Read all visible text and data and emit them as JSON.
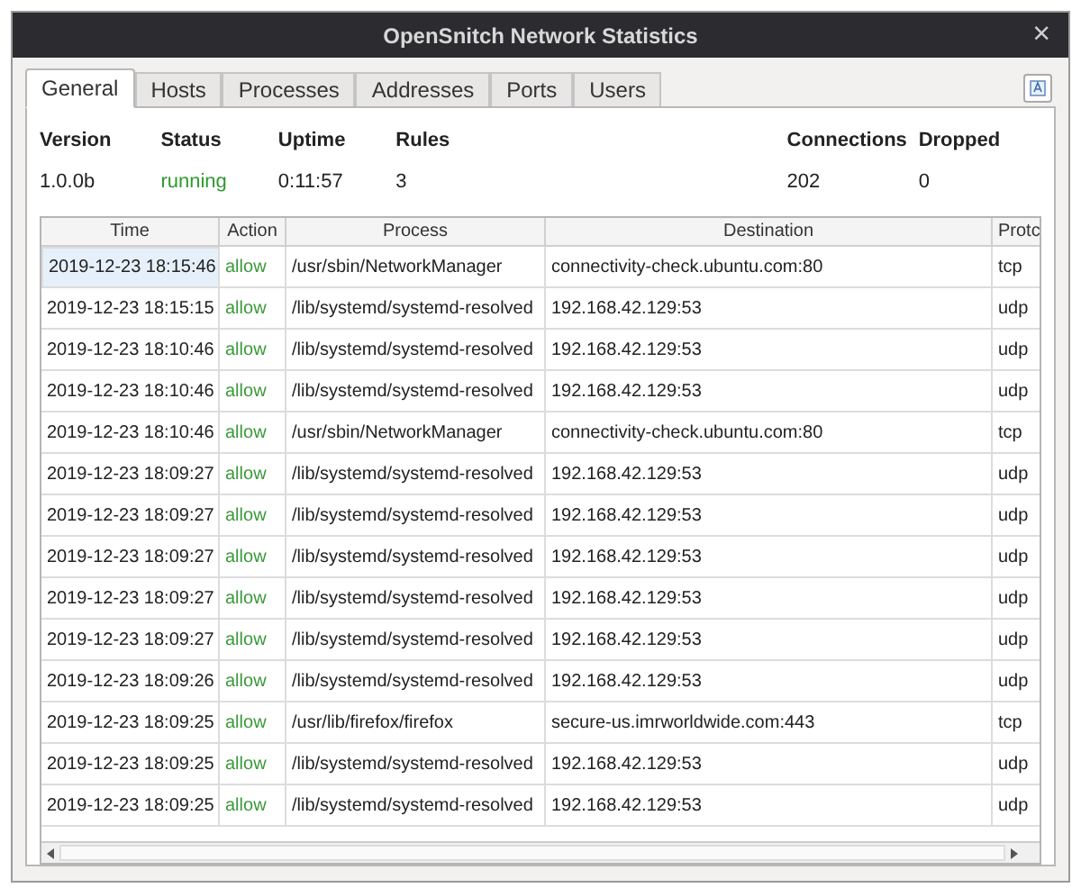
{
  "window": {
    "title": "OpenSnitch Network Statistics",
    "close": "×"
  },
  "tabs": [
    {
      "label": "General",
      "selected": true
    },
    {
      "label": "Hosts",
      "selected": false
    },
    {
      "label": "Processes",
      "selected": false
    },
    {
      "label": "Addresses",
      "selected": false
    },
    {
      "label": "Ports",
      "selected": false
    },
    {
      "label": "Users",
      "selected": false
    }
  ],
  "stats": [
    {
      "label": "Version",
      "value": "1.0.0b",
      "kind": "plain"
    },
    {
      "label": "Status",
      "value": "running",
      "kind": "status"
    },
    {
      "label": "Uptime",
      "value": "0:11:57",
      "kind": "plain"
    },
    {
      "label": "Rules",
      "value": "3",
      "kind": "plain"
    },
    {
      "label": "Connections",
      "value": "202",
      "kind": "plain"
    },
    {
      "label": "Dropped",
      "value": "0",
      "kind": "plain"
    }
  ],
  "table": {
    "columns": [
      "Time",
      "Action",
      "Process",
      "Destination",
      "Protc"
    ],
    "rows": [
      {
        "cells": [
          "2019-12-23 18:15:46",
          "allow",
          "/usr/sbin/NetworkManager",
          "connectivity-check.ubuntu.com:80",
          "tcp"
        ],
        "selected": true
      },
      {
        "cells": [
          "2019-12-23 18:15:15",
          "allow",
          "/lib/systemd/systemd-resolved",
          "192.168.42.129:53",
          "udp"
        ],
        "selected": false
      },
      {
        "cells": [
          "2019-12-23 18:10:46",
          "allow",
          "/lib/systemd/systemd-resolved",
          "192.168.42.129:53",
          "udp"
        ],
        "selected": false
      },
      {
        "cells": [
          "2019-12-23 18:10:46",
          "allow",
          "/lib/systemd/systemd-resolved",
          "192.168.42.129:53",
          "udp"
        ],
        "selected": false
      },
      {
        "cells": [
          "2019-12-23 18:10:46",
          "allow",
          "/usr/sbin/NetworkManager",
          "connectivity-check.ubuntu.com:80",
          "tcp"
        ],
        "selected": false
      },
      {
        "cells": [
          "2019-12-23 18:09:27",
          "allow",
          "/lib/systemd/systemd-resolved",
          "192.168.42.129:53",
          "udp"
        ],
        "selected": false
      },
      {
        "cells": [
          "2019-12-23 18:09:27",
          "allow",
          "/lib/systemd/systemd-resolved",
          "192.168.42.129:53",
          "udp"
        ],
        "selected": false
      },
      {
        "cells": [
          "2019-12-23 18:09:27",
          "allow",
          "/lib/systemd/systemd-resolved",
          "192.168.42.129:53",
          "udp"
        ],
        "selected": false
      },
      {
        "cells": [
          "2019-12-23 18:09:27",
          "allow",
          "/lib/systemd/systemd-resolved",
          "192.168.42.129:53",
          "udp"
        ],
        "selected": false
      },
      {
        "cells": [
          "2019-12-23 18:09:27",
          "allow",
          "/lib/systemd/systemd-resolved",
          "192.168.42.129:53",
          "udp"
        ],
        "selected": false
      },
      {
        "cells": [
          "2019-12-23 18:09:26",
          "allow",
          "/lib/systemd/systemd-resolved",
          "192.168.42.129:53",
          "udp"
        ],
        "selected": false
      },
      {
        "cells": [
          "2019-12-23 18:09:25",
          "allow",
          "/usr/lib/firefox/firefox",
          "secure-us.imrworldwide.com:443",
          "tcp"
        ],
        "selected": false
      },
      {
        "cells": [
          "2019-12-23 18:09:25",
          "allow",
          "/lib/systemd/systemd-resolved",
          "192.168.42.129:53",
          "udp"
        ],
        "selected": false
      },
      {
        "cells": [
          "2019-12-23 18:09:25",
          "allow",
          "/lib/systemd/systemd-resolved",
          "192.168.42.129:53",
          "udp"
        ],
        "selected": false
      }
    ]
  }
}
